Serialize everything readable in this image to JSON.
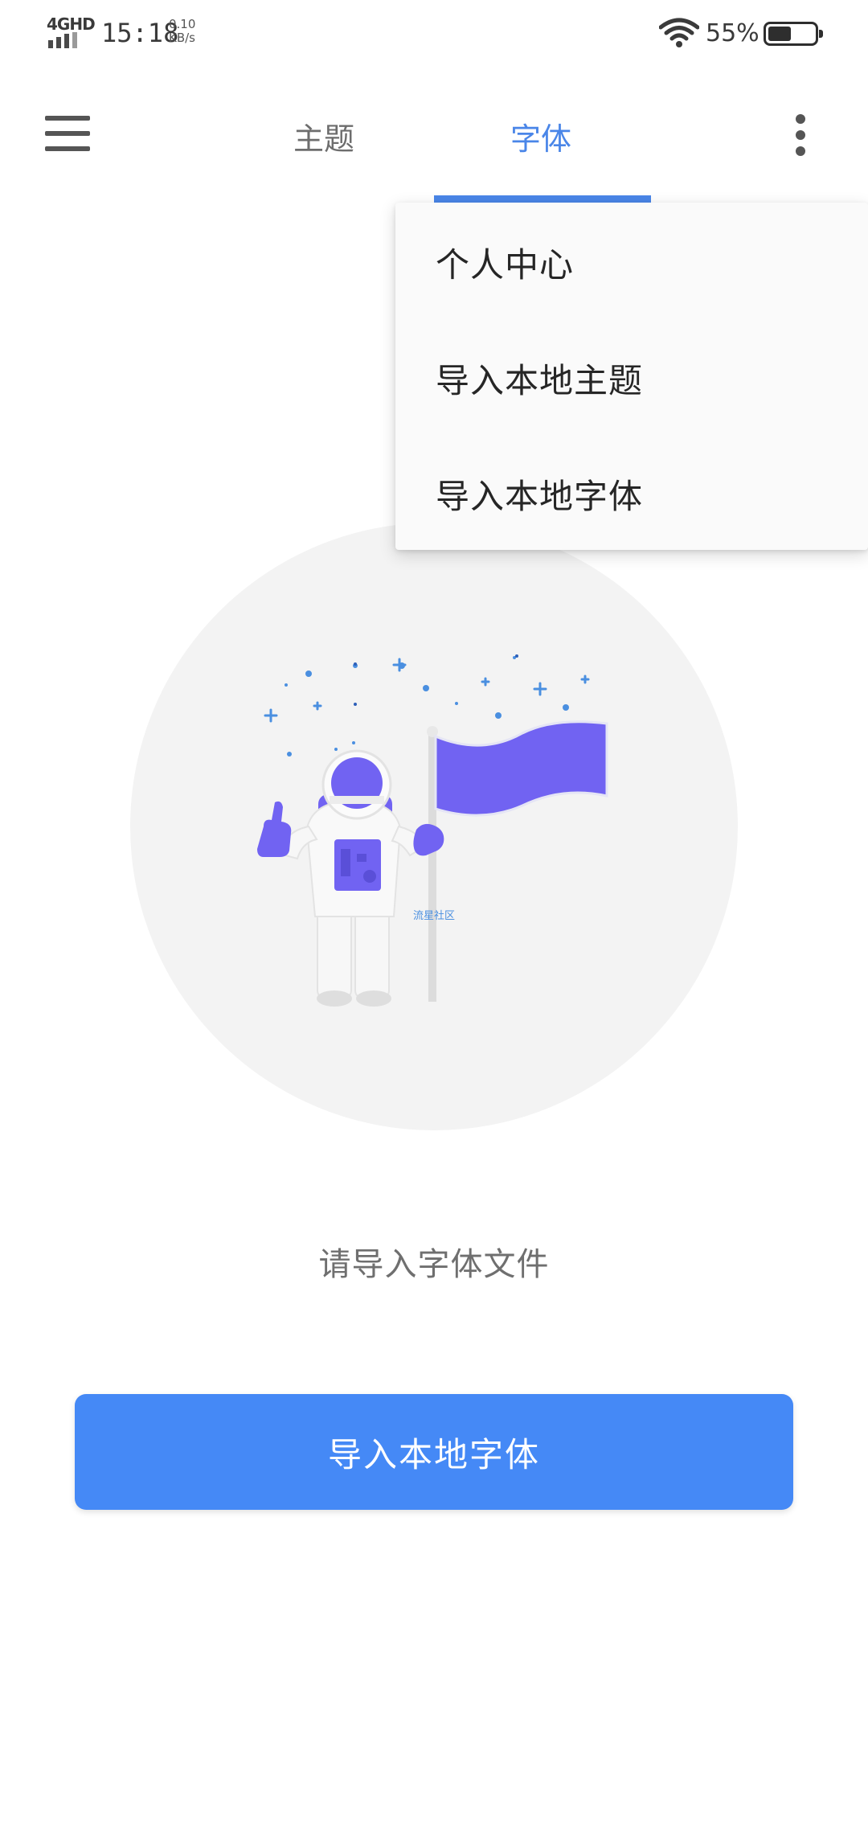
{
  "status_bar": {
    "network_label": "4GHD",
    "time": "15:18",
    "speed_value": "0.10",
    "speed_unit": "KB/s",
    "battery_percent": "55%",
    "icons": [
      "signal-icon",
      "wifi-icon",
      "battery-icon"
    ]
  },
  "toolbar": {
    "tabs": [
      {
        "label": "主题",
        "active": false
      },
      {
        "label": "字体",
        "active": true
      }
    ],
    "accent_color": "#4a86e8",
    "icons": [
      "menu-icon",
      "more-vert-icon"
    ]
  },
  "dropdown_menu": {
    "items": [
      {
        "label": "个人中心"
      },
      {
        "label": "导入本地主题"
      },
      {
        "label": "导入本地字体"
      }
    ]
  },
  "illustration": {
    "icon": "astronaut-flag-icon",
    "watermark": "流星社区",
    "colors": {
      "primary": "#7163f2",
      "star": "#4a8fe0"
    }
  },
  "main": {
    "empty_text": "请导入字体文件",
    "import_button_label": "导入本地字体",
    "button_color": "#4589f6"
  }
}
